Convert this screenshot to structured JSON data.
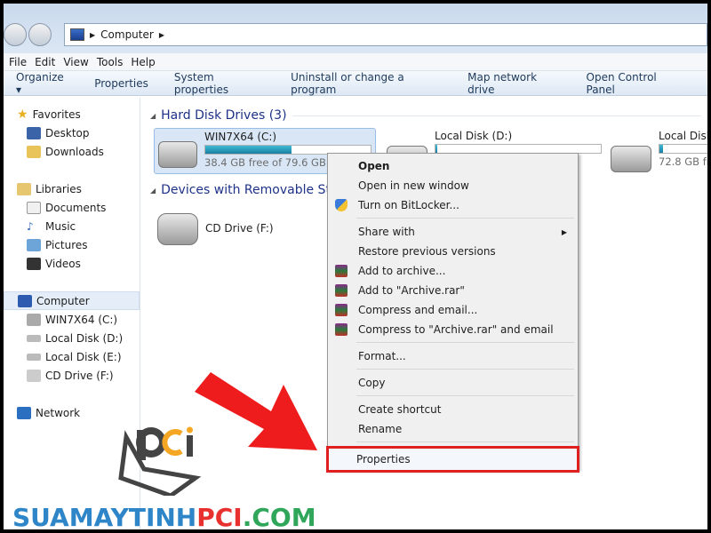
{
  "address": {
    "path": "Computer"
  },
  "menubar": [
    "File",
    "Edit",
    "View",
    "Tools",
    "Help"
  ],
  "commandbar": [
    "Organize ▾",
    "Properties",
    "System properties",
    "Uninstall or change a program",
    "Map network drive",
    "Open Control Panel"
  ],
  "sidebar": {
    "favorites": {
      "label": "Favorites",
      "items": [
        "Desktop",
        "Downloads"
      ]
    },
    "libraries": {
      "label": "Libraries",
      "items": [
        "Documents",
        "Music",
        "Pictures",
        "Videos"
      ]
    },
    "computer": {
      "label": "Computer",
      "items": [
        "WIN7X64 (C:)",
        "Local Disk (D:)",
        "Local Disk (E:)",
        "CD Drive (F:)"
      ]
    },
    "network": {
      "label": "Network"
    }
  },
  "content": {
    "hdd_group": "Hard Disk Drives (3)",
    "removable_group": "Devices with Removable Sto",
    "drives": [
      {
        "name": "WIN7X64 (C:)",
        "free": "38.4 GB free of 79.6 GB",
        "used_percent": 52
      },
      {
        "name": "Local Disk (D:)",
        "free": "",
        "used_percent": 1
      },
      {
        "name": "Local Disk (",
        "free": "72.8 GB free",
        "used_percent": 2
      }
    ],
    "cd": "CD Drive (F:)"
  },
  "context_menu": {
    "open": "Open",
    "open_new": "Open in new window",
    "bitlocker": "Turn on BitLocker...",
    "share": "Share with",
    "restore": "Restore previous versions",
    "add_archive": "Add to archive...",
    "add_rar": "Add to \"Archive.rar\"",
    "compress_email": "Compress and email...",
    "compress_rar_email": "Compress to \"Archive.rar\" and email",
    "format": "Format...",
    "copy": "Copy",
    "shortcut": "Create shortcut",
    "rename": "Rename",
    "properties": "Properties"
  },
  "watermark": {
    "part1": "SUAMAYTINH",
    "part2": "PCI",
    "part3": ".COM",
    "logo": "pci",
    "colors": {
      "part1": "#2e86c8",
      "part2": "#e8312f",
      "part3": "#2fa65a"
    }
  },
  "colors": {
    "highlight": "#e02020",
    "arrow": "#ee1c1c"
  }
}
